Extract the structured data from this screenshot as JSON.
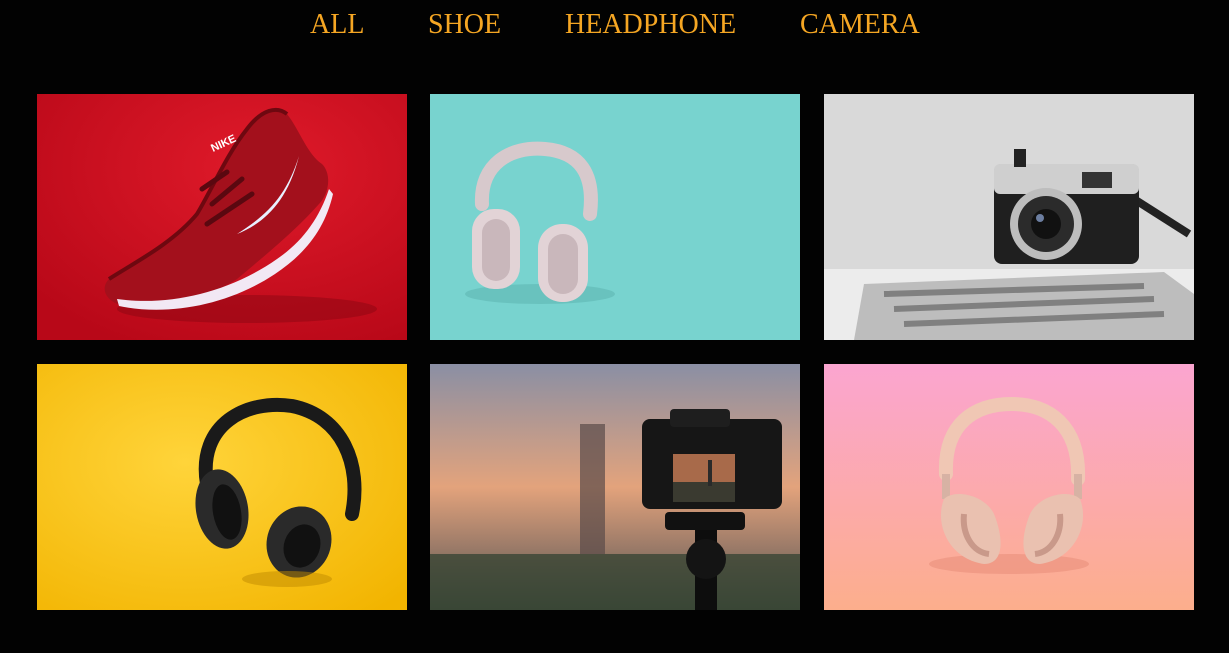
{
  "nav": {
    "items": [
      {
        "label": "ALL"
      },
      {
        "label": "SHOE"
      },
      {
        "label": "HEADPHONE"
      },
      {
        "label": "CAMERA"
      }
    ]
  },
  "colors": {
    "background": "#020202",
    "nav_text": "#f5a623"
  },
  "gallery": {
    "items": [
      {
        "category": "shoe",
        "depicts": "red-nike-sneaker",
        "background": "#d20f1f"
      },
      {
        "category": "headphone",
        "depicts": "pink-headphones",
        "background": "#78d3cf"
      },
      {
        "category": "camera",
        "depicts": "silver-retro-camera",
        "background": "#d6d6d6"
      },
      {
        "category": "headphone",
        "depicts": "black-headphones",
        "background": "#f8c21a"
      },
      {
        "category": "camera",
        "depicts": "camera-on-tripod-sunset",
        "background": "#c98a78"
      },
      {
        "category": "headphone",
        "depicts": "rose-gold-headphones",
        "background": "#fba8c4"
      }
    ]
  },
  "icons": {
    "logo_text": "NIKE"
  }
}
